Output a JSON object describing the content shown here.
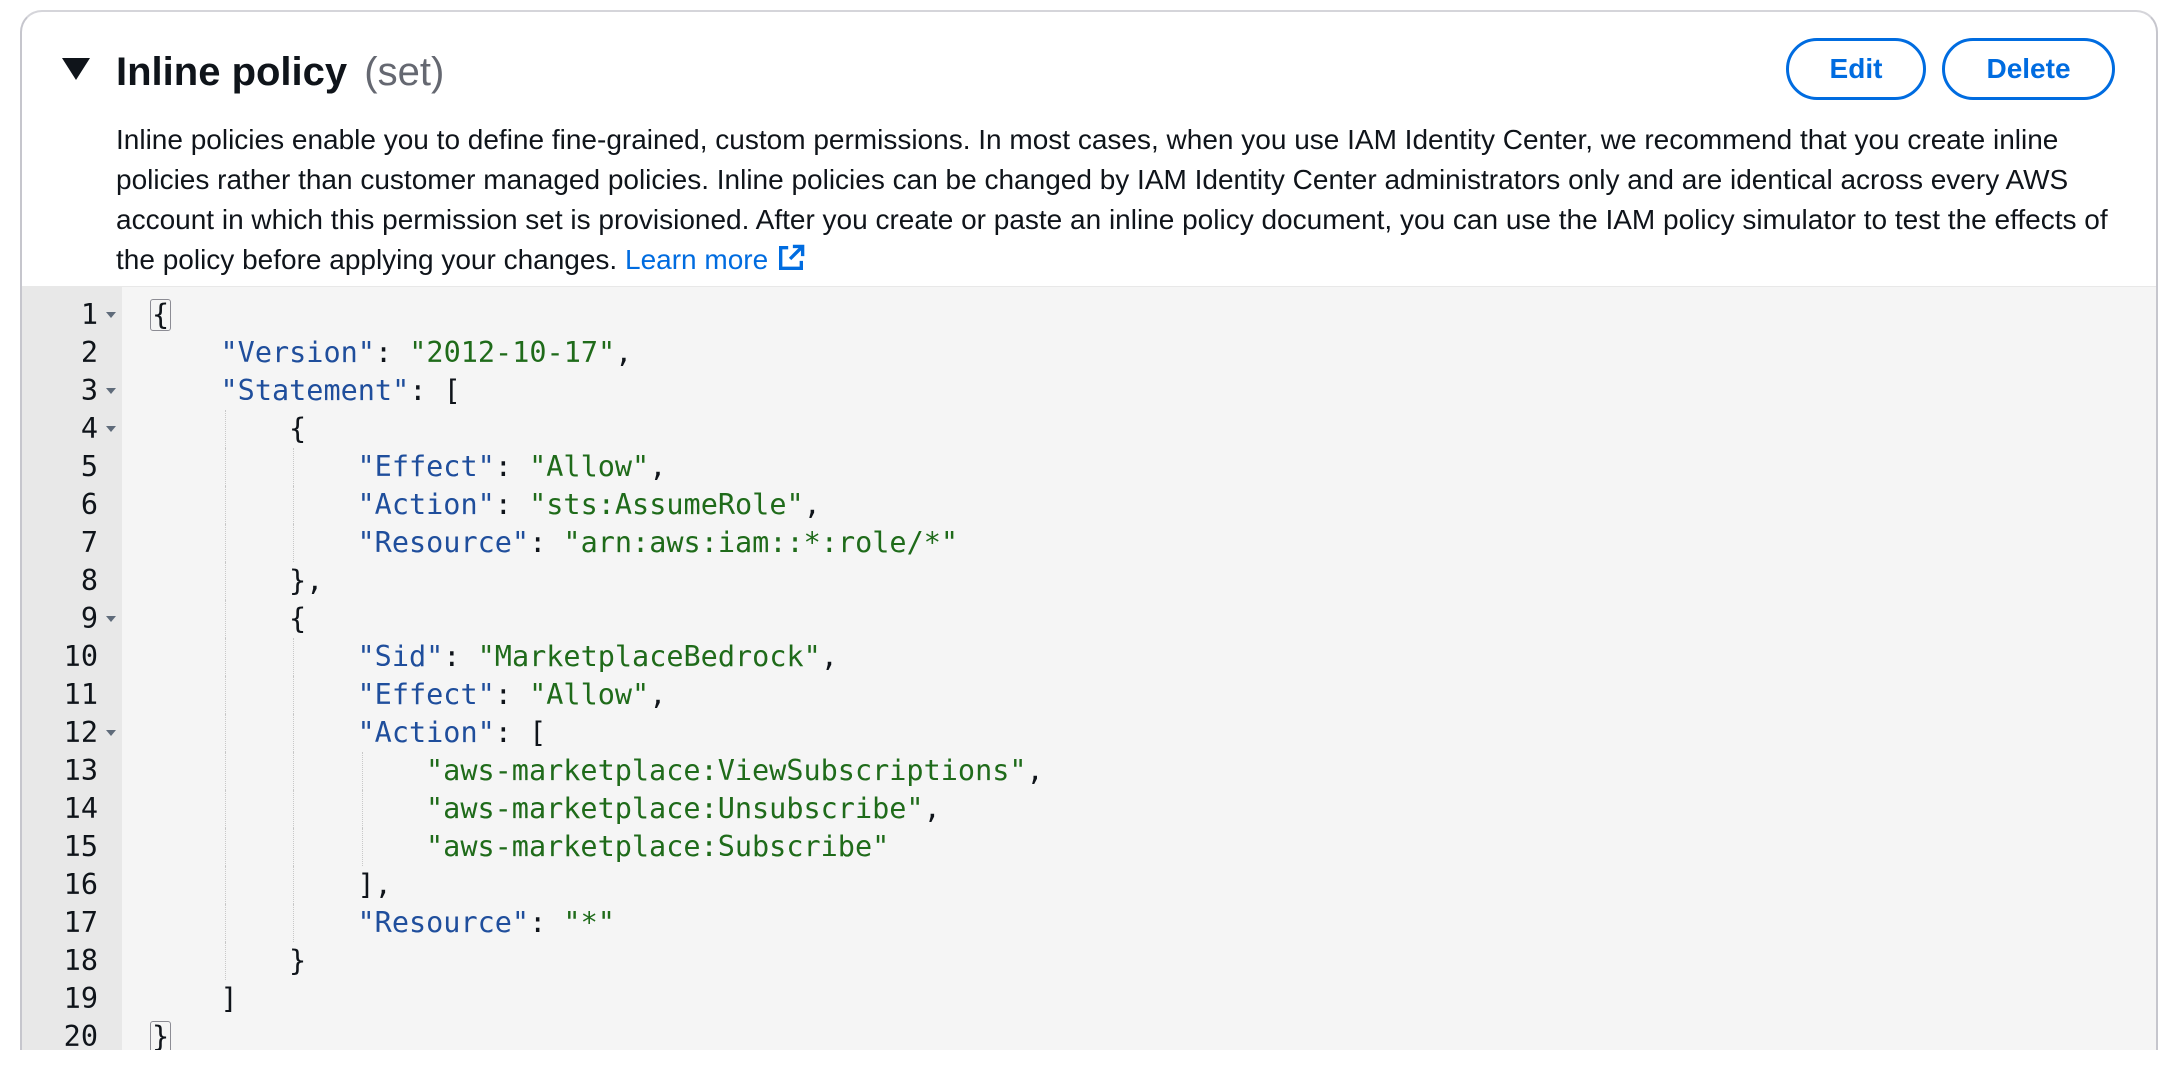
{
  "section": {
    "title": "Inline policy",
    "title_suffix": "(set)",
    "edit_label": "Edit",
    "delete_label": "Delete",
    "description": "Inline policies enable you to define fine-grained, custom permissions. In most cases, when you use IAM Identity Center, we recommend that you create inline policies rather than customer managed policies. Inline policies can be changed by IAM Identity Center administrators only and are identical across every AWS account in which this permission set is provisioned. After you create or paste an inline policy document, you can use the IAM policy simulator to test the effects of the policy before applying your changes.",
    "learn_more_label": "Learn more"
  },
  "colors": {
    "accent": "#006ce0",
    "json_key": "#1f4e9c",
    "json_string": "#1f6b1a",
    "gutter_bg": "#e8e8e8",
    "editor_bg": "#f5f5f5"
  },
  "editor": {
    "lines": [
      {
        "n": "1",
        "fold": true,
        "indent": 0,
        "tokens": [
          [
            "hl",
            "{"
          ]
        ]
      },
      {
        "n": "2",
        "fold": false,
        "indent": 1,
        "tokens": [
          [
            "k",
            "\"Version\""
          ],
          [
            "p",
            ": "
          ],
          [
            "s",
            "\"2012-10-17\""
          ],
          [
            "p",
            ","
          ]
        ]
      },
      {
        "n": "3",
        "fold": true,
        "indent": 1,
        "tokens": [
          [
            "k",
            "\"Statement\""
          ],
          [
            "p",
            ": ["
          ]
        ]
      },
      {
        "n": "4",
        "fold": true,
        "indent": 2,
        "tokens": [
          [
            "p",
            "{"
          ]
        ]
      },
      {
        "n": "5",
        "fold": false,
        "indent": 3,
        "tokens": [
          [
            "k",
            "\"Effect\""
          ],
          [
            "p",
            ": "
          ],
          [
            "s",
            "\"Allow\""
          ],
          [
            "p",
            ","
          ]
        ]
      },
      {
        "n": "6",
        "fold": false,
        "indent": 3,
        "tokens": [
          [
            "k",
            "\"Action\""
          ],
          [
            "p",
            ": "
          ],
          [
            "s",
            "\"sts:AssumeRole\""
          ],
          [
            "p",
            ","
          ]
        ]
      },
      {
        "n": "7",
        "fold": false,
        "indent": 3,
        "tokens": [
          [
            "k",
            "\"Resource\""
          ],
          [
            "p",
            ": "
          ],
          [
            "s",
            "\"arn:aws:iam::*:role/*\""
          ]
        ]
      },
      {
        "n": "8",
        "fold": false,
        "indent": 2,
        "tokens": [
          [
            "p",
            "},"
          ]
        ]
      },
      {
        "n": "9",
        "fold": true,
        "indent": 2,
        "tokens": [
          [
            "p",
            "{"
          ]
        ]
      },
      {
        "n": "10",
        "fold": false,
        "indent": 3,
        "tokens": [
          [
            "k",
            "\"Sid\""
          ],
          [
            "p",
            ": "
          ],
          [
            "s",
            "\"MarketplaceBedrock\""
          ],
          [
            "p",
            ","
          ]
        ]
      },
      {
        "n": "11",
        "fold": false,
        "indent": 3,
        "tokens": [
          [
            "k",
            "\"Effect\""
          ],
          [
            "p",
            ": "
          ],
          [
            "s",
            "\"Allow\""
          ],
          [
            "p",
            ","
          ]
        ]
      },
      {
        "n": "12",
        "fold": true,
        "indent": 3,
        "tokens": [
          [
            "k",
            "\"Action\""
          ],
          [
            "p",
            ": ["
          ]
        ]
      },
      {
        "n": "13",
        "fold": false,
        "indent": 4,
        "tokens": [
          [
            "s",
            "\"aws-marketplace:ViewSubscriptions\""
          ],
          [
            "p",
            ","
          ]
        ]
      },
      {
        "n": "14",
        "fold": false,
        "indent": 4,
        "tokens": [
          [
            "s",
            "\"aws-marketplace:Unsubscribe\""
          ],
          [
            "p",
            ","
          ]
        ]
      },
      {
        "n": "15",
        "fold": false,
        "indent": 4,
        "tokens": [
          [
            "s",
            "\"aws-marketplace:Subscribe\""
          ]
        ]
      },
      {
        "n": "16",
        "fold": false,
        "indent": 3,
        "tokens": [
          [
            "p",
            "],"
          ]
        ]
      },
      {
        "n": "17",
        "fold": false,
        "indent": 3,
        "tokens": [
          [
            "k",
            "\"Resource\""
          ],
          [
            "p",
            ": "
          ],
          [
            "s",
            "\"*\""
          ]
        ]
      },
      {
        "n": "18",
        "fold": false,
        "indent": 2,
        "tokens": [
          [
            "p",
            "}"
          ]
        ]
      },
      {
        "n": "19",
        "fold": false,
        "indent": 1,
        "tokens": [
          [
            "p",
            "]"
          ]
        ]
      },
      {
        "n": "20",
        "fold": false,
        "indent": 0,
        "tokens": [
          [
            "hl",
            "}"
          ]
        ]
      }
    ]
  }
}
